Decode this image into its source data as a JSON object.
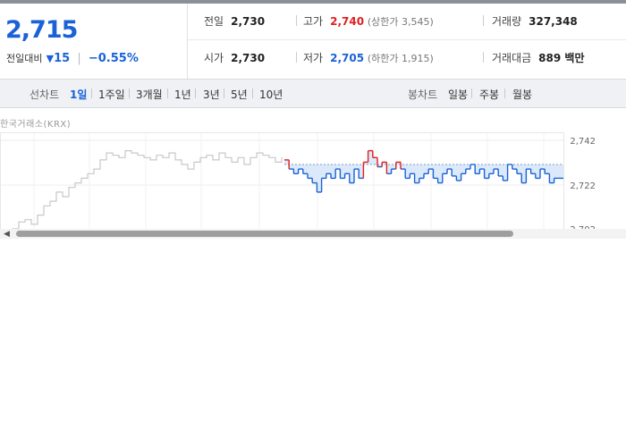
{
  "quote": {
    "price": "2,715",
    "change_label": "전일대비",
    "change_icon": "down-triangle-icon",
    "change_value": "15",
    "change_rate": "−0.55%"
  },
  "info": {
    "prev_close_label": "전일",
    "prev_close": "2,730",
    "high_label": "고가",
    "high": "2,740",
    "upper_limit": "(상한가 3,545)",
    "volume_label": "거래량",
    "volume": "327,348",
    "open_label": "시가",
    "open": "2,730",
    "low_label": "저가",
    "low": "2,705",
    "lower_limit": "(하한가 1,915)",
    "amount_label": "거래대금",
    "amount": "889 백만"
  },
  "controls": {
    "line_label": "선차트",
    "line_tabs": [
      "1일",
      "1주일",
      "3개월",
      "1년",
      "3년",
      "5년",
      "10년"
    ],
    "line_active": "1일",
    "candle_label": "봉차트",
    "candle_tabs": [
      "일봉",
      "주봉",
      "월봉"
    ]
  },
  "source": "한국거래소(KRX)",
  "chart_data": {
    "type": "line",
    "y_ticks": [
      "2,742",
      "2,722"
    ],
    "reference_price": 2730,
    "y_range_visible": [
      2702,
      2744
    ],
    "colors": {
      "today_line": "#1a62d6",
      "prev_line": "#c8c8c8",
      "above_ref": "#e02020",
      "fill": "#dbe9fa"
    },
    "prev_series": [
      2700,
      2698,
      2702,
      2705,
      2706,
      2704,
      2708,
      2712,
      2714,
      2718,
      2716,
      2720,
      2722,
      2724,
      2726,
      2728,
      2732,
      2735,
      2734,
      2733,
      2736,
      2735,
      2734,
      2733,
      2732,
      2734,
      2733,
      2735,
      2732,
      2730,
      2728,
      2731,
      2733,
      2734,
      2732,
      2735,
      2733,
      2731,
      2733,
      2730,
      2733,
      2735,
      2734,
      2733,
      2731,
      2733
    ],
    "today_series": [
      2732,
      2728,
      2726,
      2728,
      2726,
      2724,
      2722,
      2718,
      2724,
      2726,
      2724,
      2728,
      2724,
      2726,
      2722,
      2728,
      2724,
      2731,
      2736,
      2733,
      2729,
      2731,
      2726,
      2728,
      2731,
      2728,
      2724,
      2726,
      2722,
      2724,
      2726,
      2728,
      2724,
      2722,
      2726,
      2728,
      2725,
      2723,
      2726,
      2728,
      2730,
      2726,
      2728,
      2724,
      2726,
      2728,
      2725,
      2723,
      2730,
      2728,
      2726,
      2722,
      2728,
      2726,
      2724,
      2728,
      2726,
      2722,
      2724,
      2724
    ]
  }
}
